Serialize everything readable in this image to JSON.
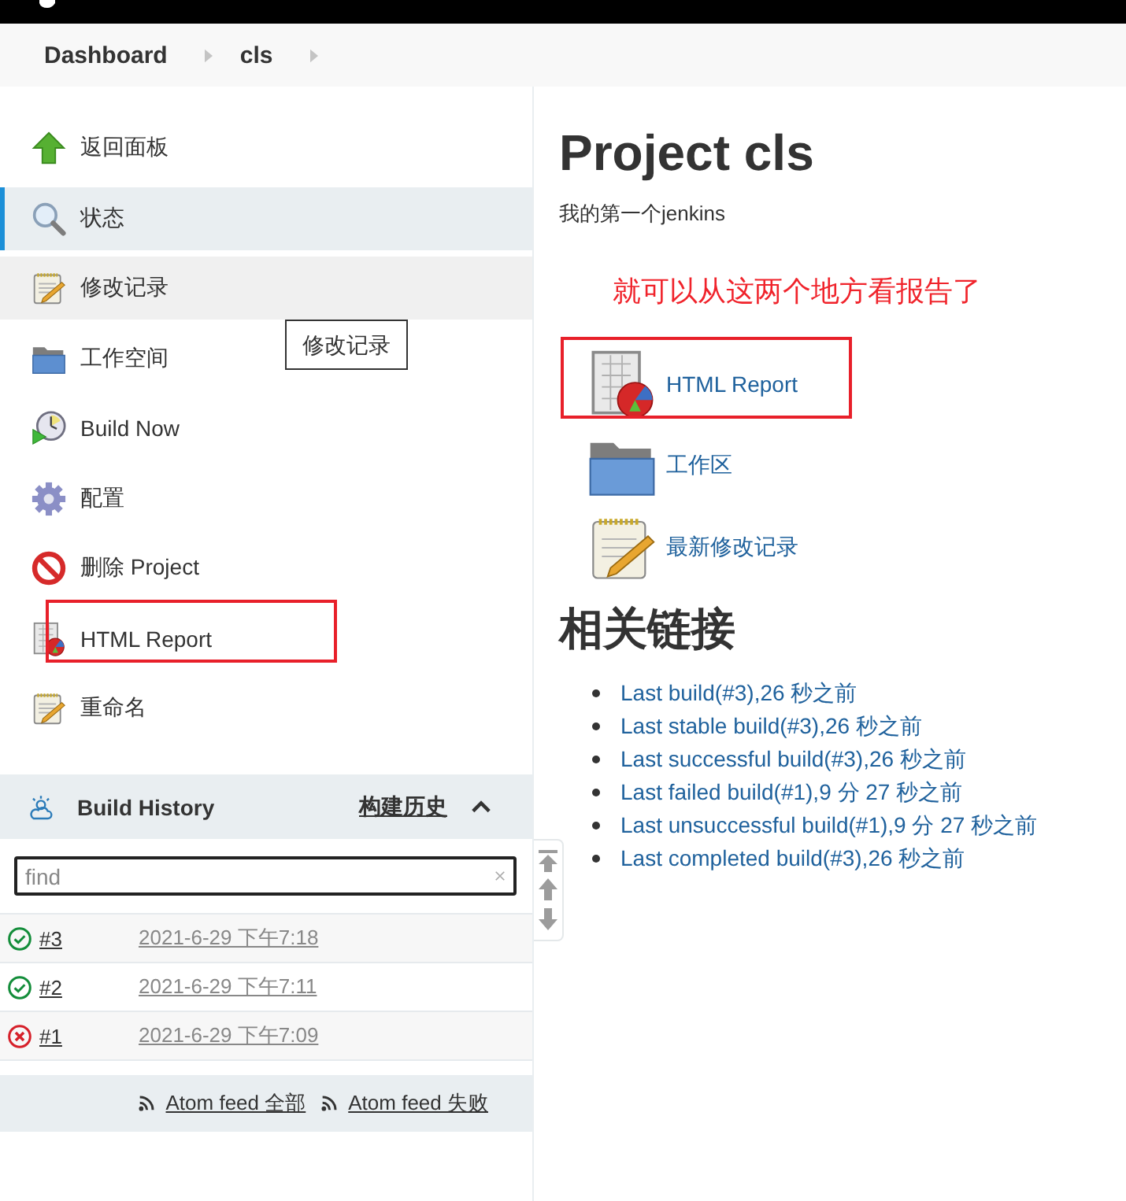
{
  "breadcrumbs": [
    {
      "label": "Dashboard"
    },
    {
      "label": "cls"
    }
  ],
  "sidebar": {
    "items": [
      {
        "label": "返回面板",
        "selected": false,
        "hovered": false,
        "annotated": false
      },
      {
        "label": "状态",
        "selected": true,
        "hovered": false,
        "annotated": false
      },
      {
        "label": "修改记录",
        "selected": false,
        "hovered": true,
        "annotated": false
      },
      {
        "label": "工作空间",
        "selected": false,
        "hovered": false,
        "annotated": false
      },
      {
        "label": "Build Now",
        "selected": false,
        "hovered": false,
        "annotated": false
      },
      {
        "label": "配置",
        "selected": false,
        "hovered": false,
        "annotated": false
      },
      {
        "label": "删除 Project",
        "selected": false,
        "hovered": false,
        "annotated": false
      },
      {
        "label": "HTML Report",
        "selected": false,
        "hovered": false,
        "annotated": true
      },
      {
        "label": "重命名",
        "selected": false,
        "hovered": false,
        "annotated": false
      }
    ],
    "tooltip": {
      "text": "修改记录"
    }
  },
  "build_history": {
    "title": "Build History",
    "link": "构建历史",
    "expanded": true,
    "search": {
      "placeholder": "find"
    },
    "builds": [
      {
        "number": "#3",
        "date": "2021-6-29 下午7:18",
        "kind": "success"
      },
      {
        "number": "#2",
        "date": "2021-6-29 下午7:11",
        "kind": "success"
      },
      {
        "number": "#1",
        "date": "2021-6-29 下午7:09",
        "kind": "failure"
      }
    ],
    "feeds": [
      {
        "label": "Atom feed 全部"
      },
      {
        "label": "Atom feed 失败"
      }
    ]
  },
  "main": {
    "title": "Project cls",
    "description": "我的第一个jenkins",
    "annotation": "就可以从这两个地方看报告了",
    "tasks": [
      {
        "label": "HTML Report",
        "annotated": true
      },
      {
        "label": "工作区",
        "annotated": false
      },
      {
        "label": "最新修改记录",
        "annotated": false
      }
    ],
    "related_title": "相关链接",
    "related_links": [
      {
        "label": "Last build(#3),26 秒之前"
      },
      {
        "label": "Last stable build(#3),26 秒之前"
      },
      {
        "label": "Last successful build(#3),26 秒之前"
      },
      {
        "label": "Last failed build(#1),9 分 27 秒之前"
      },
      {
        "label": "Last unsuccessful build(#1),9 分 27 秒之前"
      },
      {
        "label": "Last completed build(#3),26 秒之前"
      }
    ]
  }
}
